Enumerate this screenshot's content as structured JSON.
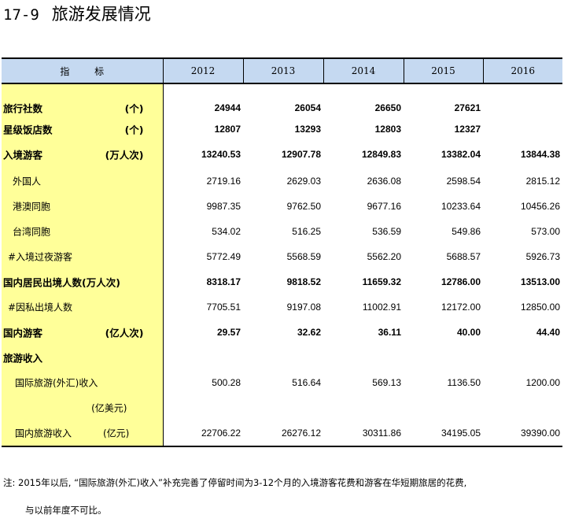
{
  "title": {
    "number": "17-9",
    "text": "旅游发展情况"
  },
  "table": {
    "header": {
      "indicator": "指 标",
      "years": [
        "2012",
        "2013",
        "2014",
        "2015",
        "2016"
      ]
    },
    "rows": [
      {
        "label": "旅行社数",
        "unit": "(个)",
        "values": [
          "24944",
          "26054",
          "26650",
          "27621",
          ""
        ]
      },
      {
        "label": "星级饭店数",
        "unit": "(个)",
        "values": [
          "12807",
          "13293",
          "12803",
          "12327",
          ""
        ]
      },
      {
        "label": "入境游客",
        "unit": "(万人次)",
        "values": [
          "13240.53",
          "12907.78",
          "12849.83",
          "13382.04",
          "13844.38"
        ]
      },
      {
        "label": "外国人",
        "unit": "",
        "values": [
          "2719.16",
          "2629.03",
          "2636.08",
          "2598.54",
          "2815.12"
        ]
      },
      {
        "label": "港澳同胞",
        "unit": "",
        "values": [
          "9987.35",
          "9762.50",
          "9677.16",
          "10233.64",
          "10456.26"
        ]
      },
      {
        "label": "台湾同胞",
        "unit": "",
        "values": [
          "534.02",
          "516.25",
          "536.59",
          "549.86",
          "573.00"
        ]
      },
      {
        "label": "#入境过夜游客",
        "unit": "",
        "values": [
          "5772.49",
          "5568.59",
          "5562.20",
          "5688.57",
          "5926.73"
        ]
      },
      {
        "label": "国内居民出境人数(万人次)",
        "unit": "",
        "values": [
          "8318.17",
          "9818.52",
          "11659.32",
          "12786.00",
          "13513.00"
        ]
      },
      {
        "label": "#因私出境人数",
        "unit": "",
        "values": [
          "7705.51",
          "9197.08",
          "11002.91",
          "12172.00",
          "12850.00"
        ]
      },
      {
        "label": "国内游客",
        "unit": "(亿人次)",
        "values": [
          "29.57",
          "32.62",
          "36.11",
          "40.00",
          "44.40"
        ]
      },
      {
        "label": "旅游收入",
        "unit": "",
        "values": [
          "",
          "",
          "",
          "",
          ""
        ]
      },
      {
        "label": "国际旅游(外汇)收入",
        "unit": "",
        "values": [
          "500.28",
          "516.64",
          "569.13",
          "1136.50",
          "1200.00"
        ]
      },
      {
        "label": "",
        "unit": "(亿美元)",
        "values": [
          "",
          "",
          "",
          "",
          ""
        ]
      },
      {
        "label": "国内旅游收入",
        "unit": "(亿元)",
        "values": [
          "22706.22",
          "26276.12",
          "30311.86",
          "34195.05",
          "39390.00"
        ]
      }
    ]
  },
  "footnote": {
    "line1": "注: 2015年以后, “国际旅游(外汇)收入”补充完善了停留时间为3-12个月的入境游客花费和游客在华短期旅居的花费,",
    "line2": "与以前年度不可比。"
  },
  "colors": {
    "header_bg": "#c5d9f1",
    "label_bg": "#ffff99"
  }
}
